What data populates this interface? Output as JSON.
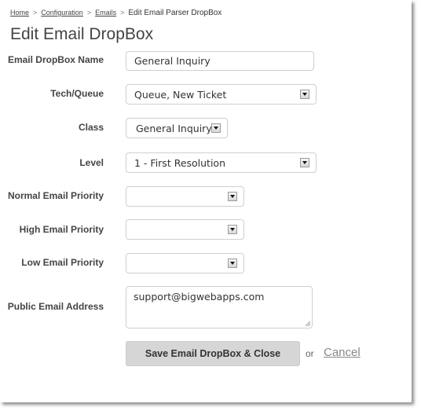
{
  "breadcrumb": {
    "items": [
      "Home",
      "Configuration",
      "Emails"
    ],
    "separator": ">",
    "current": "Edit Email Parser DropBox"
  },
  "page_title": "Edit Email DropBox",
  "form": {
    "name": {
      "label": "Email DropBox Name",
      "value": "General Inquiry"
    },
    "tech_queue": {
      "label": "Tech/Queue",
      "value": "Queue, New Ticket"
    },
    "class": {
      "label": "Class",
      "value": "General Inquiry"
    },
    "level": {
      "label": "Level",
      "value": "1 - First Resolution"
    },
    "normal_priority": {
      "label": "Normal Email Priority",
      "value": ""
    },
    "high_priority": {
      "label": "High Email Priority",
      "value": ""
    },
    "low_priority": {
      "label": "Low Email Priority",
      "value": ""
    },
    "public_email": {
      "label": "Public Email Address",
      "value": "support@bigwebapps.com"
    }
  },
  "actions": {
    "save_label": "Save Email DropBox & Close",
    "or_text": "or",
    "cancel_label": "Cancel"
  },
  "icons": {
    "dropdown": "chevron-down-icon",
    "resize": "resize-grip-icon"
  }
}
